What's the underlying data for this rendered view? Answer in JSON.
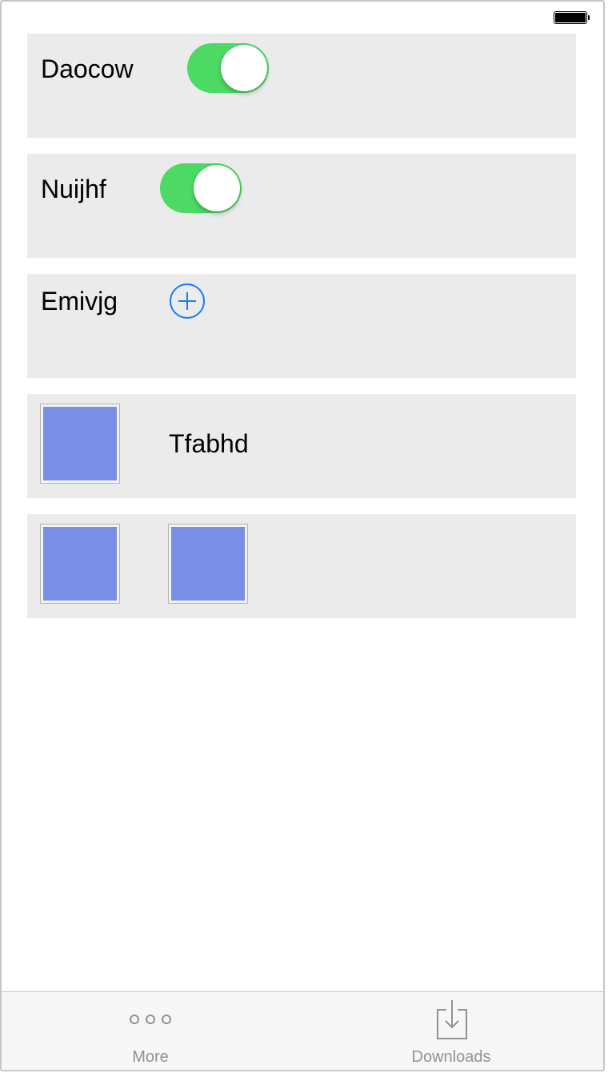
{
  "status_bar": {
    "battery": "full"
  },
  "rows": [
    {
      "label": "Daocow",
      "control": "toggle",
      "on": true
    },
    {
      "label": "Nuijhf",
      "control": "toggle",
      "on": true
    },
    {
      "label": "Emivjg",
      "control": "add-button"
    },
    {
      "label": "Tfabhd",
      "control": "thumbnail"
    },
    {
      "control": "thumbnails",
      "count": 2
    }
  ],
  "tabbar": {
    "more_label": "More",
    "downloads_label": "Downloads"
  },
  "colors": {
    "toggle_on": "#4cd964",
    "accent": "#147efb",
    "thumbnail": "#7a90e6",
    "card_bg": "#ebebeb",
    "tab_inactive": "#929292"
  },
  "icons": {
    "more": "more-dots-icon",
    "downloads": "download-tray-icon",
    "add": "plus-circle-icon"
  }
}
